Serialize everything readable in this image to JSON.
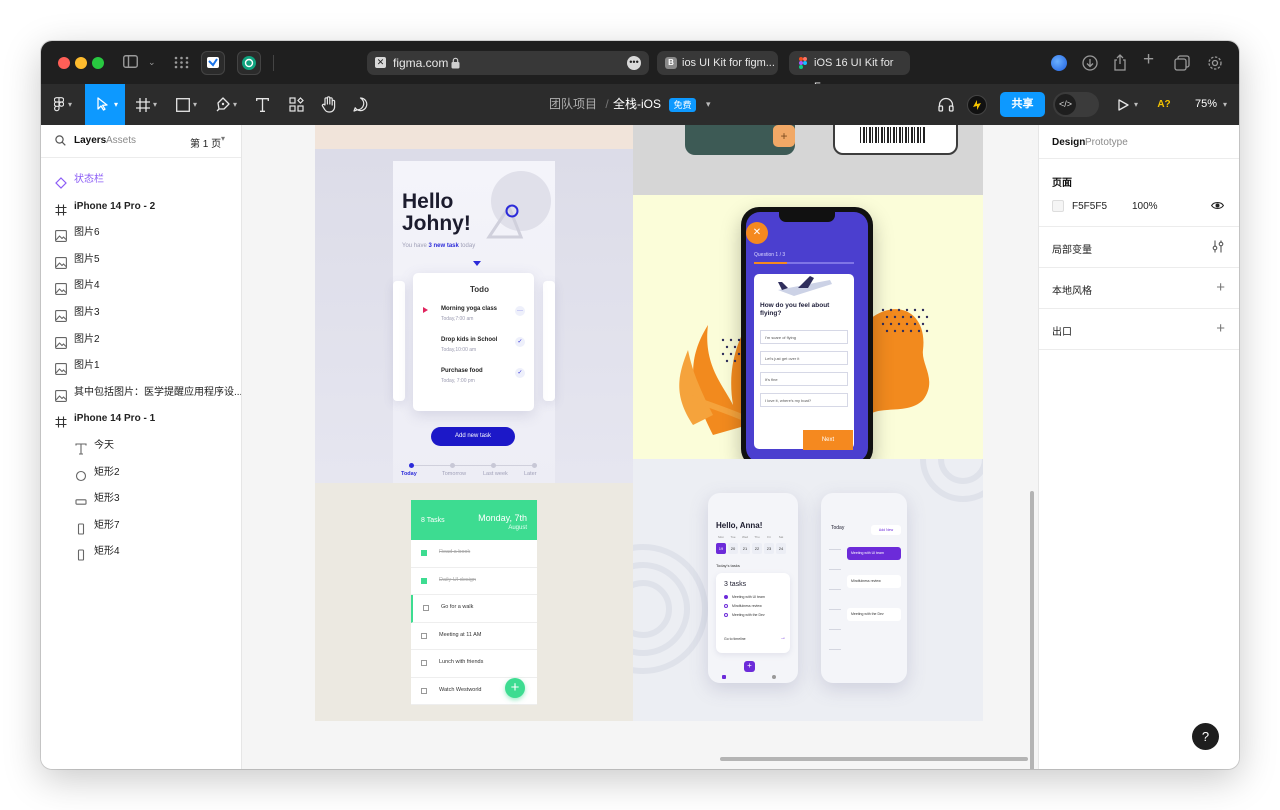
{
  "browser": {
    "url": "figma.com",
    "tabs": [
      {
        "label": "ios UI Kit for figm..."
      },
      {
        "label": "iOS 16 UI Kit for F..."
      }
    ]
  },
  "toolbar": {
    "breadcrumb_team": "团队项目",
    "breadcrumb_separator": "/",
    "project_name": "全栈-iOS",
    "plan_badge": "免费",
    "share_label": "共享",
    "missing_fonts": "A?",
    "zoom": "75%"
  },
  "left_panel": {
    "tab_layers": "Layers",
    "tab_assets": "Assets",
    "page_selector": "第 1 页",
    "layers": [
      {
        "name": "状态栏",
        "icon": "component-icon"
      },
      {
        "name": "iPhone 14 Pro - 2",
        "icon": "frame-icon"
      },
      {
        "name": "图片6",
        "icon": "image-icon"
      },
      {
        "name": "图片5",
        "icon": "image-icon"
      },
      {
        "name": "图片4",
        "icon": "image-icon"
      },
      {
        "name": "图片3",
        "icon": "image-icon"
      },
      {
        "name": "图片2",
        "icon": "image-icon"
      },
      {
        "name": "图片1",
        "icon": "image-icon"
      },
      {
        "name": "其中包括图片：医学提醒应用程序设...",
        "icon": "image-icon"
      },
      {
        "name": "iPhone 14 Pro - 1",
        "icon": "frame-icon"
      },
      {
        "name": "今天",
        "icon": "text-icon"
      },
      {
        "name": "矩形2",
        "icon": "ellipse-icon"
      },
      {
        "name": "矩形3",
        "icon": "rectangle-icon"
      },
      {
        "name": "矩形7",
        "icon": "rectangle-icon"
      },
      {
        "name": "矩形4",
        "icon": "rectangle-icon"
      }
    ]
  },
  "right_panel": {
    "tab_design": "Design",
    "tab_prototype": "Prototype",
    "page_heading": "页面",
    "page_color": "F5F5F5",
    "page_opacity": "100%",
    "page_color_hex": "#F5F5F5",
    "local_variables": "局部变量",
    "local_styles": "本地风格",
    "export": "出口"
  },
  "canvas": {
    "todo_app": {
      "greeting": "Hello\nJohny!",
      "subtitle_prefix": "You have ",
      "subtitle_highlight": "3 new task",
      "subtitle_suffix": " today",
      "card_title": "Todo",
      "tasks": [
        {
          "title": "Morning yoga class",
          "time": "Today,7:00 am"
        },
        {
          "title": "Drop kids in School",
          "time": "Today,10:00 am"
        },
        {
          "title": "Purchase food",
          "time": "Today, 7:00 pm"
        }
      ],
      "add_button": "Add new task",
      "tabs": [
        "Today",
        "Tomorrow",
        "Last week",
        "Later"
      ]
    },
    "quiz_app": {
      "progress": "Question 1 / 3",
      "question": "How do you feel about flying?",
      "options": [
        "I'm scare of flying",
        "Let's just get over it",
        "It's fine",
        "I love it, where's my boat?"
      ],
      "next": "Next"
    },
    "tasks_app": {
      "count": "8 Tasks",
      "date": "Monday, 7th",
      "month": "August",
      "items": [
        {
          "label": "Read a book",
          "done": true
        },
        {
          "label": "Daily UI design",
          "done": true
        },
        {
          "label": "Go for a walk",
          "done": false
        },
        {
          "label": "Meeting at 11 AM",
          "done": false
        },
        {
          "label": "Lunch with friends",
          "done": false
        },
        {
          "label": "Watch Westworld",
          "done": false
        }
      ],
      "accent": "#3ddc91"
    },
    "anna_app": {
      "greeting": "Hello, Anna!",
      "days": [
        "Mon",
        "Tue",
        "Wed",
        "Thu",
        "Fri",
        "Sat"
      ],
      "dates": [
        "19",
        "20",
        "21",
        "22",
        "23",
        "24"
      ],
      "section": "Today's tasks",
      "tasks_count": "3 tasks",
      "tasks": [
        "Meeting with UI team",
        "Mindfulness review",
        "Meeting with the Dev"
      ],
      "timeline_link": "Go to timeline",
      "today_label": "Today",
      "add_new": "Add New",
      "events": [
        "Meeting with UI team",
        "Mindfulness review",
        "Meeting with the Dev"
      ],
      "accent": "#6c2bd9"
    }
  }
}
